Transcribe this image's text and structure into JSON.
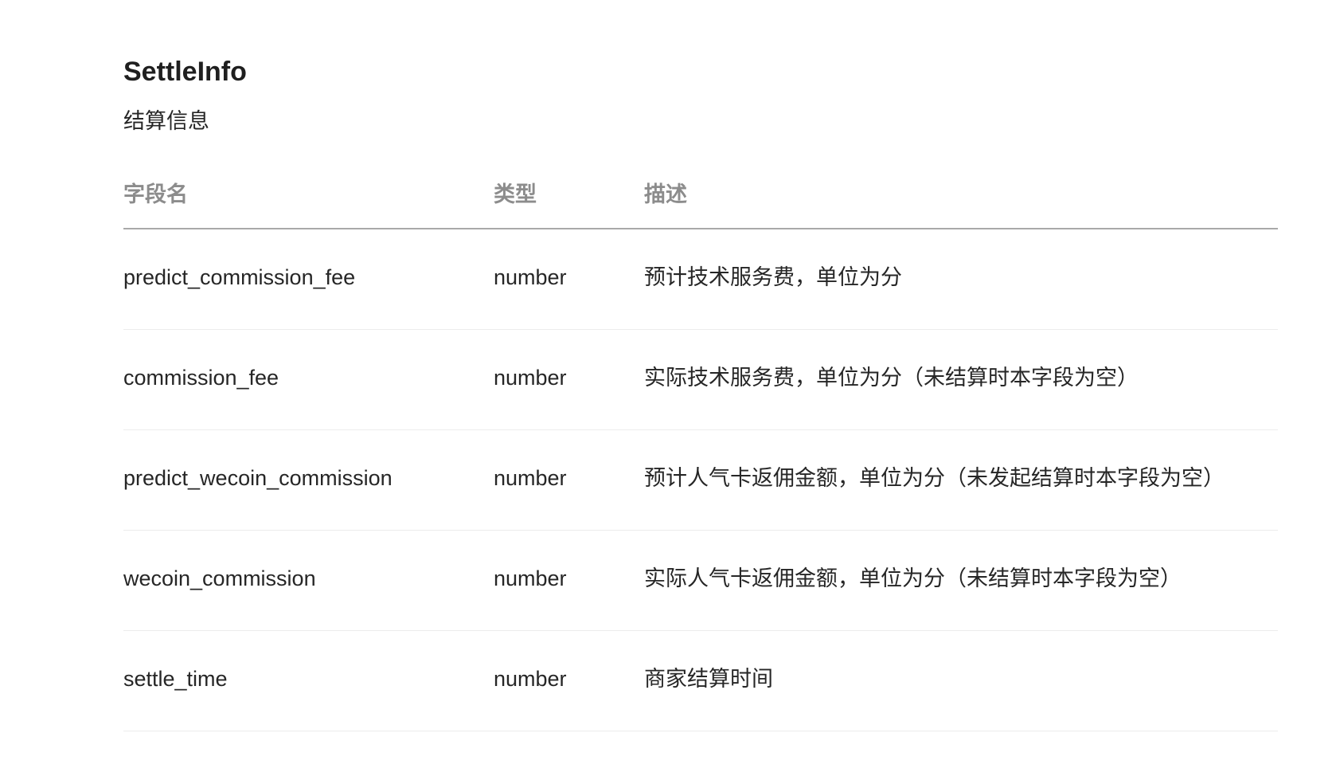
{
  "section": {
    "title": "SettleInfo",
    "subtitle": "结算信息"
  },
  "table": {
    "headers": {
      "field": "字段名",
      "type": "类型",
      "description": "描述"
    },
    "rows": [
      {
        "field": "predict_commission_fee",
        "type": "number",
        "description": "预计技术服务费，单位为分"
      },
      {
        "field": "commission_fee",
        "type": "number",
        "description": "实际技术服务费，单位为分（未结算时本字段为空）"
      },
      {
        "field": "predict_wecoin_commission",
        "type": "number",
        "description": "预计人气卡返佣金额，单位为分（未发起结算时本字段为空）"
      },
      {
        "field": "wecoin_commission",
        "type": "number",
        "description": "实际人气卡返佣金额，单位为分（未结算时本字段为空）"
      },
      {
        "field": "settle_time",
        "type": "number",
        "description": "商家结算时间"
      }
    ]
  }
}
